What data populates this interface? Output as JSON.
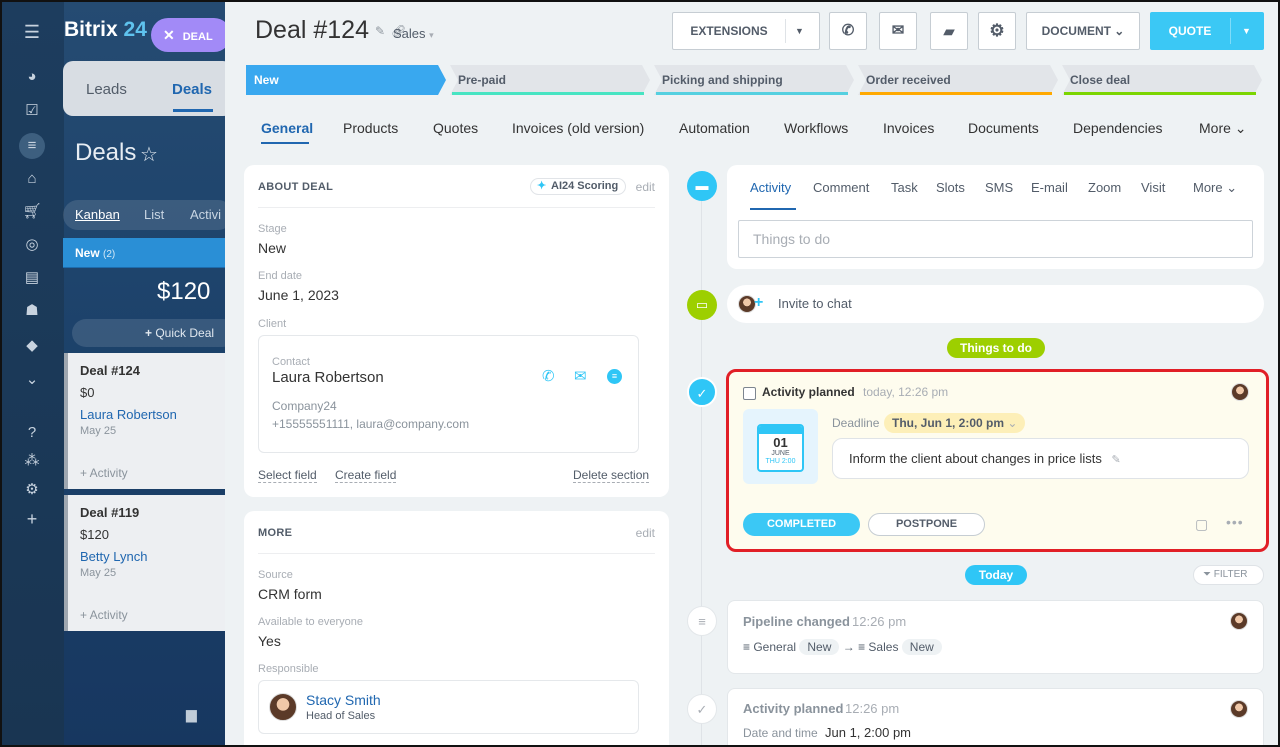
{
  "app": {
    "logo_main": "Bitrix",
    "logo_num": "24",
    "deal_pill": "DEAL"
  },
  "crm_bg": {
    "tabs": [
      "Leads",
      "Deals"
    ],
    "title": "Deals",
    "views": [
      "Kanban",
      "List",
      "Activi"
    ],
    "column": {
      "name": "New",
      "count": "(2)",
      "sum": "$120",
      "quick_deal": "Quick Deal"
    },
    "cards": [
      {
        "name": "Deal #124",
        "amount": "$0",
        "person": "Laura Robertson",
        "date": "May 25",
        "activity": "+ Activity"
      },
      {
        "name": "Deal #119",
        "amount": "$120",
        "person": "Betty Lynch",
        "date": "May 25",
        "activity": "+ Activity"
      }
    ]
  },
  "deal": {
    "title": "Deal #124",
    "category": "Sales"
  },
  "toolbar": {
    "extensions": "EXTENSIONS",
    "document": "DOCUMENT",
    "quote": "QUOTE"
  },
  "stages": [
    {
      "label": "New",
      "color": "#39a8ef",
      "active": true
    },
    {
      "label": "Pre-paid",
      "color": "#47e4c2",
      "active": false
    },
    {
      "label": "Picking and shipping",
      "color": "#55d0e0",
      "active": false
    },
    {
      "label": "Order received",
      "color": "#ffa900",
      "active": false
    },
    {
      "label": "Close deal",
      "color": "#7bd500",
      "active": false
    }
  ],
  "tabs": [
    "General",
    "Products",
    "Quotes",
    "Invoices (old version)",
    "Automation",
    "Workflows",
    "Invoices",
    "Documents",
    "Dependencies",
    "More"
  ],
  "about": {
    "header": "ABOUT DEAL",
    "ai_label": "AI24 Scoring",
    "edit": "edit",
    "stage_label": "Stage",
    "stage_value": "New",
    "end_label": "End date",
    "end_value": "June 1, 2023",
    "client_label": "Client",
    "contact_label": "Contact",
    "contact_name": "Laura Robertson",
    "company": "Company24",
    "contact_info": "+15555551111, laura@company.com",
    "select_field": "Select field",
    "create_field": "Create field",
    "delete_section": "Delete section"
  },
  "more_section": {
    "header": "MORE",
    "edit": "edit",
    "source_label": "Source",
    "source_value": "CRM form",
    "avail_label": "Available to everyone",
    "avail_value": "Yes",
    "resp_label": "Responsible",
    "resp_name": "Stacy Smith",
    "resp_title": "Head of Sales"
  },
  "editor": {
    "tabs": [
      "Activity",
      "Comment",
      "Task",
      "Slots",
      "SMS",
      "E-mail",
      "Zoom",
      "Visit",
      "More"
    ],
    "placeholder": "Things to do"
  },
  "chat": {
    "invite": "Invite to chat"
  },
  "things_badge": "Things to do",
  "activity": {
    "title": "Activity planned",
    "time": "today, 12:26 pm",
    "deadline_label": "Deadline",
    "deadline_value": "Thu, Jun 1, 2:00 pm",
    "cal_day": "01",
    "cal_month": "JUNE",
    "cal_small": "THU 2:00",
    "description": "Inform the client about changes in price lists",
    "completed": "COMPLETED",
    "postpone": "POSTPONE"
  },
  "today_badge": "Today",
  "filter": "FILTER",
  "history": [
    {
      "title": "Pipeline changed",
      "time": "12:26 pm",
      "from_pipeline": "General",
      "from_stage": "New",
      "to_pipeline": "Sales",
      "to_stage": "New"
    },
    {
      "title": "Activity planned",
      "time": "12:26 pm",
      "detail_label": "Date and time",
      "detail_value": "Jun 1, 2:00 pm"
    }
  ]
}
